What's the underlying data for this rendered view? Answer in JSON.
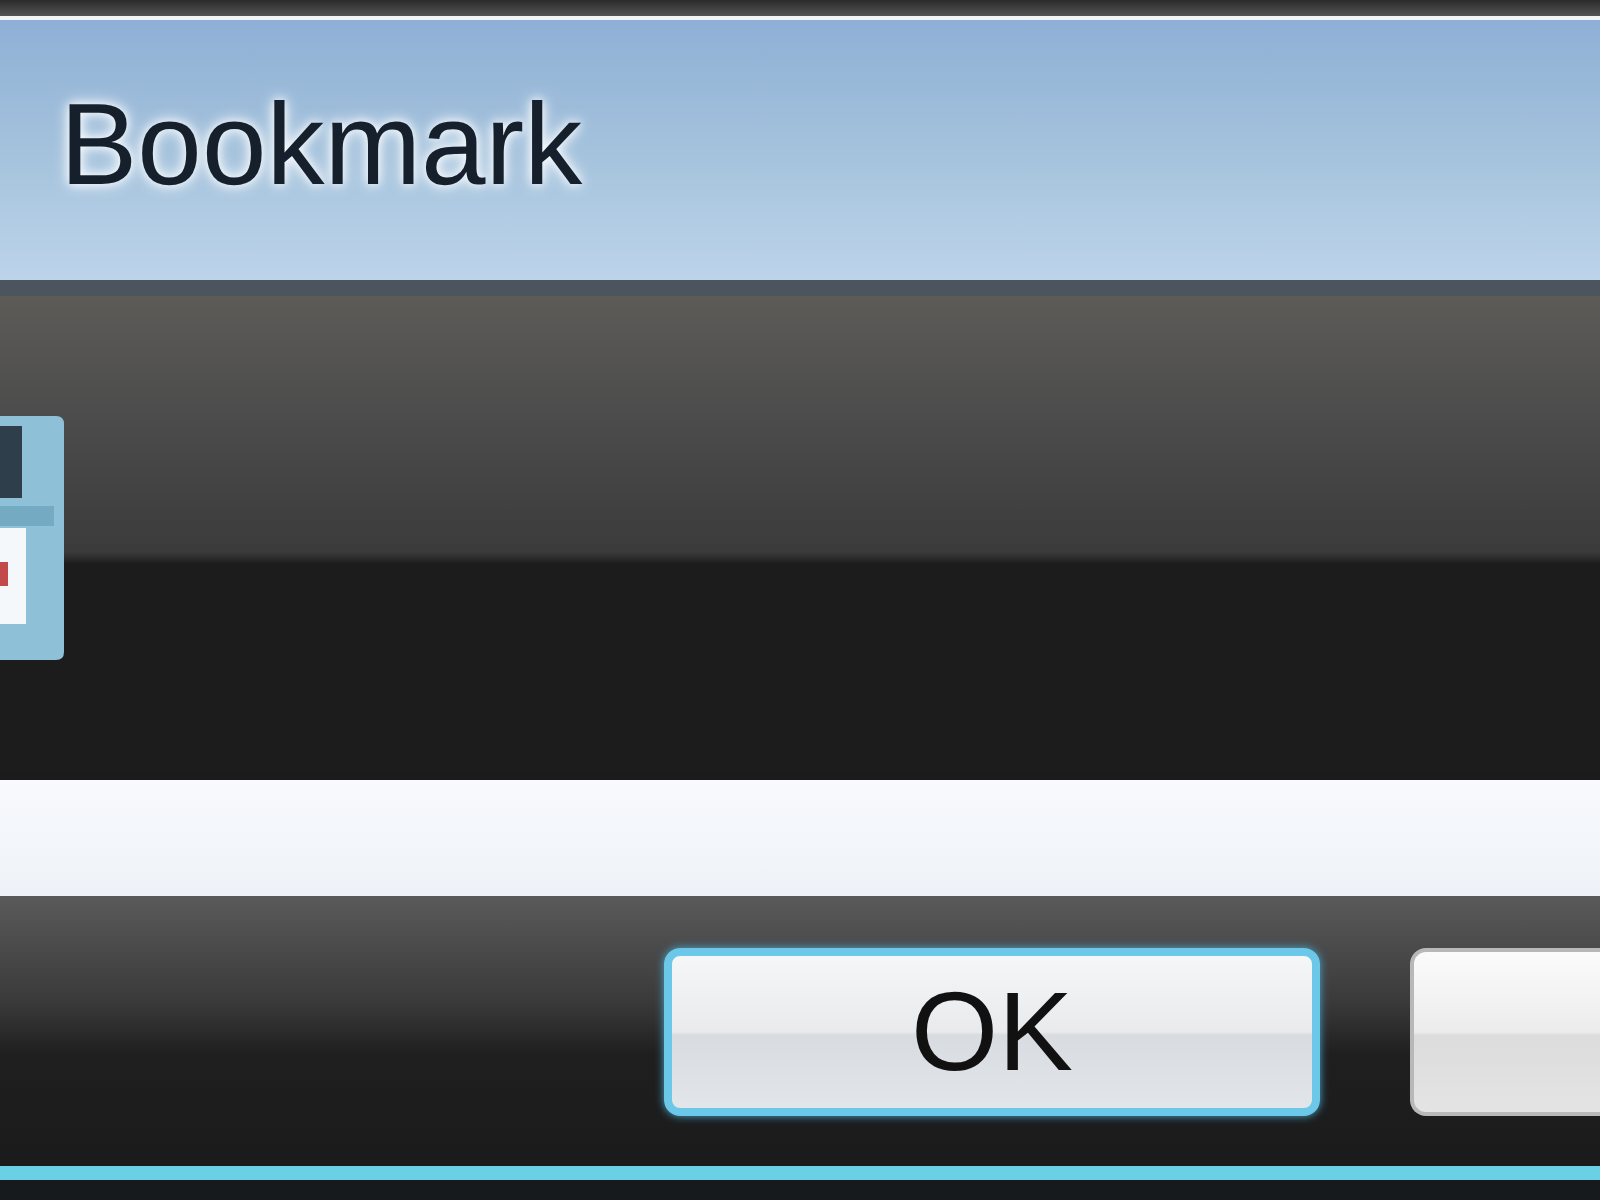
{
  "window": {
    "title": "Bookmark"
  },
  "buttons": [
    {
      "label": "OK",
      "focused": true
    },
    {
      "focused": false
    }
  ]
}
